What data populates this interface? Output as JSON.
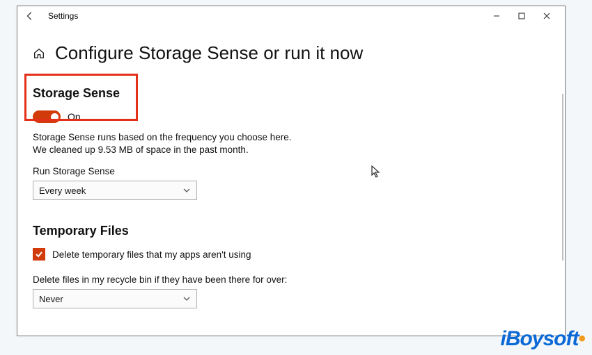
{
  "window": {
    "title": "Settings",
    "min_tooltip": "Minimize",
    "max_tooltip": "Maximize",
    "close_tooltip": "Close"
  },
  "page": {
    "title": "Configure Storage Sense or run it now"
  },
  "storage_sense": {
    "section_title": "Storage Sense",
    "toggle_state": "On",
    "description": "Storage Sense runs based on the frequency you choose here. We cleaned up 9.53 MB of space in the past month.",
    "run_label": "Run Storage Sense",
    "run_value": "Every week"
  },
  "temp_files": {
    "section_title": "Temporary Files",
    "checkbox_label": "Delete temporary files that my apps aren't using",
    "recycle_label": "Delete files in my recycle bin if they have been there for over:",
    "recycle_value": "Never"
  },
  "colors": {
    "accent": "#d13b0b",
    "highlight": "#e53019"
  },
  "watermark": "iBoysoft"
}
